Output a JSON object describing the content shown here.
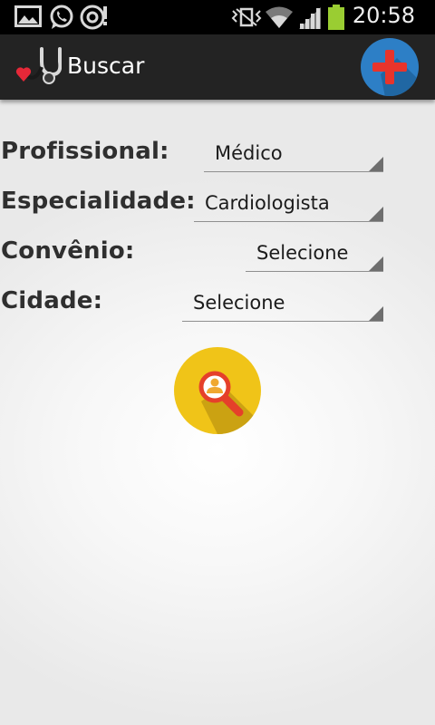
{
  "status_bar": {
    "time": "20:58",
    "icons": [
      "gallery-icon",
      "whatsapp-icon",
      "media-sync-icon",
      "vibrate-icon",
      "wifi-icon",
      "signal-icon",
      "battery-icon"
    ],
    "battery_color": "#9acd32"
  },
  "action_bar": {
    "title": "Buscar",
    "logo_icon": "stethoscope-heart-icon",
    "add_button_icon": "plus-icon",
    "add_button_color": "#2d7fc6",
    "add_icon_color": "#e8342b"
  },
  "form": {
    "profissional": {
      "label": "Profissional:",
      "value": "Médico"
    },
    "especialidade": {
      "label": "Especialidade:",
      "value": "Cardiologista"
    },
    "convenio": {
      "label": "Convênio:",
      "value": "Selecione"
    },
    "cidade": {
      "label": "Cidade:",
      "value": "Selecione"
    }
  },
  "search_button": {
    "icon": "user-search-icon",
    "color": "#f0c418",
    "magnifier_color": "#e5402a"
  }
}
